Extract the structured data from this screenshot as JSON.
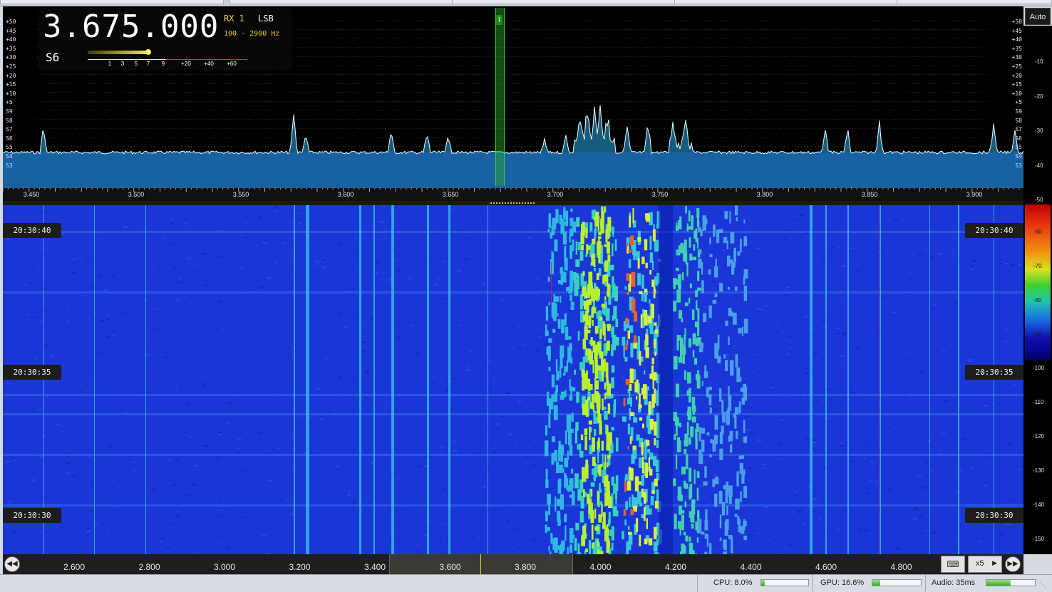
{
  "frequency": "3.675.000",
  "receiver": "RX 1",
  "mode": "LSB",
  "bandwidth": "100 - 2900 Hz",
  "s_meter": {
    "reading": "S6",
    "level_fraction": 0.38,
    "scale": [
      "1",
      "3",
      "5",
      "7",
      "9",
      "+20",
      "+40",
      "+60"
    ]
  },
  "vfo_tag": "1",
  "spectrum": {
    "db_labels": [
      "+50",
      "+45",
      "+40",
      "+35",
      "+30",
      "+25",
      "+20",
      "+15",
      "+10",
      "+5",
      "S9",
      "S8",
      "S7",
      "S6",
      "S5",
      "S4",
      "S3"
    ],
    "freq_labels": [
      "3.450",
      "3.500",
      "3.550",
      "3.600",
      "3.650",
      "3.700",
      "3.750",
      "3.800",
      "3.850",
      "3.900"
    ],
    "auto_button": "Auto",
    "side_labels": [
      "-10",
      "-20",
      "-30",
      "-40",
      "-50"
    ]
  },
  "waterfall": {
    "color_scale_labels": [
      "-60",
      "-70",
      "-80",
      "-90"
    ],
    "side_labels": [
      "-100",
      "-110",
      "-120",
      "-130",
      "-140",
      "-150"
    ],
    "timestamps": [
      "20:30:40",
      "20:30:35",
      "20:30:30"
    ]
  },
  "bottom_axis": {
    "labels": [
      "2.600",
      "2.800",
      "3.000",
      "3.200",
      "3.400",
      "3.600",
      "3.800",
      "4.000",
      "4.200",
      "4.400",
      "4.600",
      "4.800"
    ],
    "zoom": "x5",
    "prev_icon": "rewind-icon",
    "next_icon": "forward-icon",
    "keyboard_icon": "keyboard-icon"
  },
  "status": {
    "cpu": "CPU: 8.0%",
    "cpu_fraction": 0.08,
    "gpu": "GPU: 16.6%",
    "gpu_fraction": 0.166,
    "audio": "Audio: 35ms",
    "audio_fraction": 0.5
  },
  "colors": {
    "trace": "#e8ffff",
    "trace_fill": "#1d7aa8",
    "waterfall_bg": "#1b36d6",
    "vfo": "#3ccc3c",
    "freq_yellow": "#f0c83c"
  }
}
